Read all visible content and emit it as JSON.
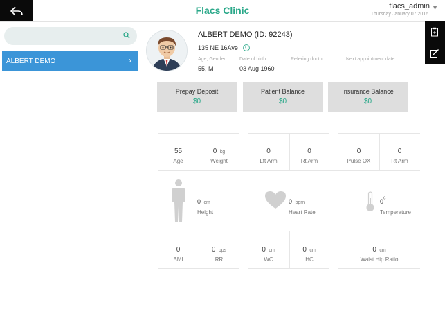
{
  "header": {
    "title": "Flacs Clinic",
    "username": "flacs_admin",
    "date": "Thursday January 07,2016"
  },
  "sidebar": {
    "search_placeholder": "",
    "patients": [
      {
        "name": "ALBERT DEMO"
      }
    ]
  },
  "patient": {
    "title": "ALBERT DEMO (ID: 92243)",
    "address": "135 NE 16Ave",
    "age_gender_label": "Age, Gender",
    "age_gender_value": "55,  M",
    "dob_label": "Date of birth",
    "dob_value": "03 Aug 1960",
    "ref_label": "Refering doctor",
    "ref_value": "",
    "next_appt_label": "Next appointment date",
    "next_appt_value": ""
  },
  "balances": [
    {
      "title": "Prepay Deposit",
      "value": "$0"
    },
    {
      "title": "Patient Balance",
      "value": "$0"
    },
    {
      "title": "Insurance Balance",
      "value": "$0"
    }
  ],
  "metrics_row1": [
    {
      "value": "55",
      "unit": "",
      "label": "Age"
    },
    {
      "value": "0",
      "unit": "kg",
      "label": "Weight"
    },
    {
      "value": "0",
      "unit": "",
      "label": "Lft Arm"
    },
    {
      "value": "0",
      "unit": "",
      "label": "Rt Arm"
    },
    {
      "value": "0",
      "unit": "",
      "label": "Pulse OX"
    },
    {
      "value": "0",
      "unit": "",
      "label": "Rt Arm"
    }
  ],
  "vitals": [
    {
      "value": "0",
      "unit": "cm",
      "label": "Height",
      "icon": "body-silhouette-icon"
    },
    {
      "value": "0",
      "unit": "bpm",
      "label": "Heart Rate",
      "icon": "heart-icon"
    },
    {
      "value": "0",
      "unit": "c",
      "label": "Temperature",
      "icon": "thermometer-icon"
    }
  ],
  "metrics_row3": [
    {
      "value": "0",
      "unit": "",
      "label": "BMI"
    },
    {
      "value": "0",
      "unit": "bps",
      "label": "RR"
    },
    {
      "value": "0",
      "unit": "cm",
      "label": "WC"
    },
    {
      "value": "0",
      "unit": "cm",
      "label": "HC"
    },
    {
      "value": "0",
      "unit": "cm",
      "label": "Waist Hip Ratio"
    }
  ],
  "colors": {
    "accent_green": "#2aa889",
    "selected_blue": "#3b95d8",
    "toolbar_black": "#0a0a0a"
  }
}
